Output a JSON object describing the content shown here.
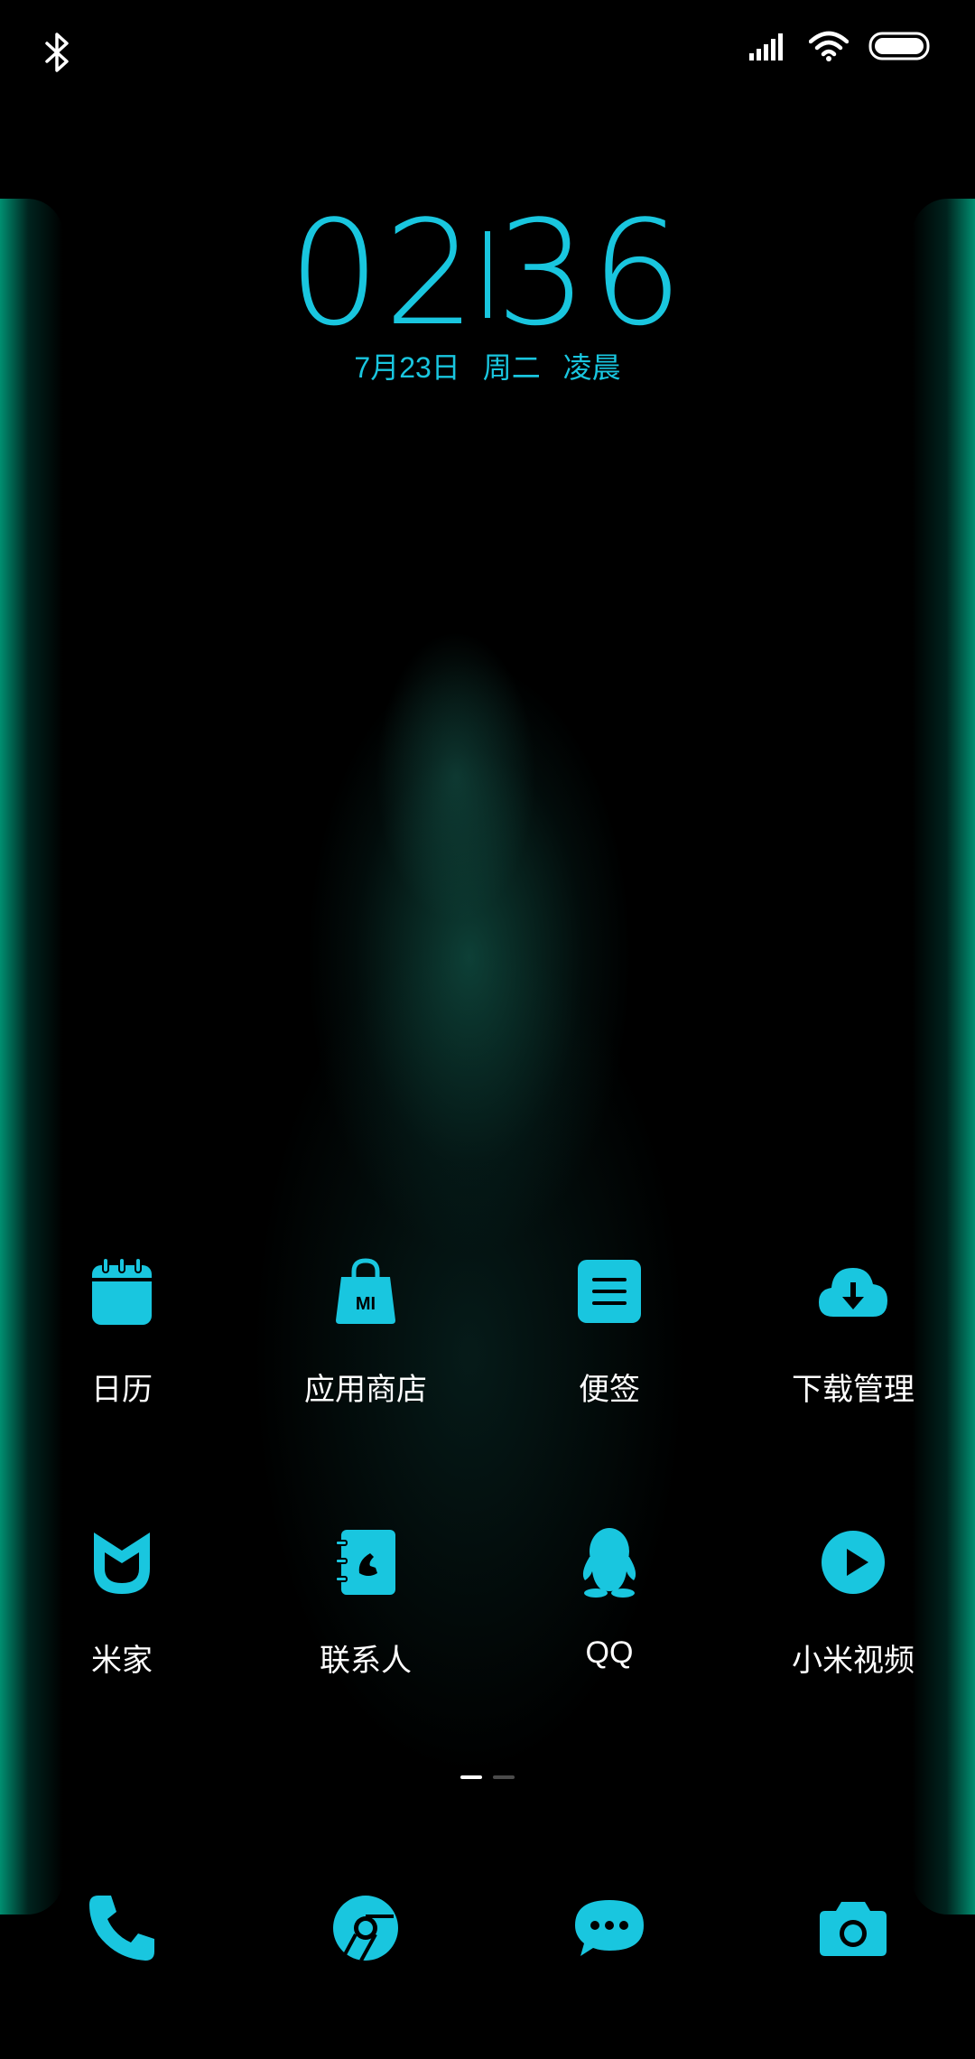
{
  "status_bar": {
    "bluetooth_icon": "bluetooth-icon",
    "signal_icon": "cellular-signal-icon",
    "wifi_icon": "wifi-icon",
    "battery_icon": "battery-icon"
  },
  "lock_clock": {
    "hours": "02",
    "minutes": "36",
    "date": "7月23日",
    "weekday": "周二",
    "period": "凌晨"
  },
  "apps": [
    {
      "label": "日历",
      "icon": "calendar-icon"
    },
    {
      "label": "应用商店",
      "icon": "app-store-bag-icon"
    },
    {
      "label": "便签",
      "icon": "notes-icon"
    },
    {
      "label": "下载管理",
      "icon": "cloud-download-icon"
    },
    {
      "label": "米家",
      "icon": "mijia-icon"
    },
    {
      "label": "联系人",
      "icon": "contacts-icon"
    },
    {
      "label": "QQ",
      "icon": "qq-penguin-icon"
    },
    {
      "label": "小米视频",
      "icon": "play-icon"
    }
  ],
  "page_indicator": {
    "pages": 2,
    "current": 1
  },
  "dock": [
    {
      "icon": "phone-icon"
    },
    {
      "icon": "browser-icon"
    },
    {
      "icon": "messages-icon"
    },
    {
      "icon": "camera-icon"
    }
  ],
  "colors": {
    "accent": "#19c6df",
    "label": "#ffffff",
    "background": "#000000",
    "edge_glow": "#00be96"
  }
}
